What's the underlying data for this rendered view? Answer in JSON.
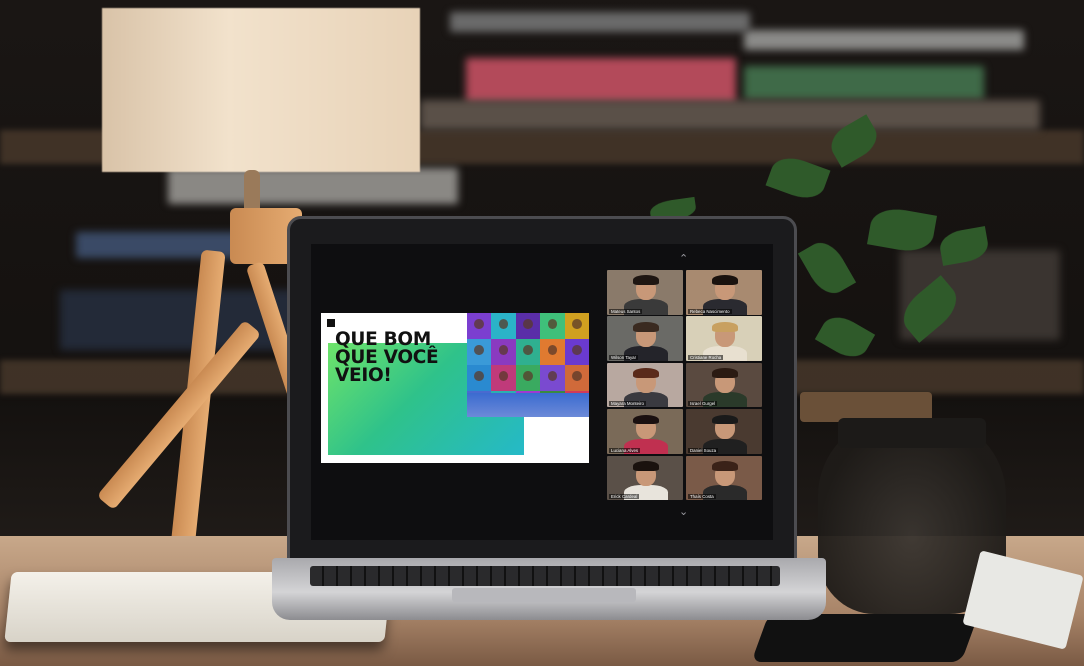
{
  "slide": {
    "title_lines": [
      "QUE BOM",
      "QUE VOCÊ",
      "VEIO!"
    ],
    "gradient_start": "#6ee36a",
    "gradient_end": "#25b9c8"
  },
  "panel": {
    "scroll_up_icon": "chevron-up-icon",
    "scroll_down_icon": "chevron-down-icon",
    "participants": [
      {
        "name": "Mateus Santos",
        "bg": "#8a7a6a",
        "shirt": "#3a3a3a",
        "hair": "#1e1612"
      },
      {
        "name": "Rebeca Nascimento",
        "bg": "#a88a70",
        "shirt": "#2a2a30",
        "hair": "#1a120e"
      },
      {
        "name": "Wilson Tayar",
        "bg": "#6a6a66",
        "shirt": "#24242a",
        "hair": "#3a2a20"
      },
      {
        "name": "Cristiane Rocha",
        "bg": "#d8d0b8",
        "shirt": "#e8e0d0",
        "hair": "#c8a060"
      },
      {
        "name": "Mayara Monteiro",
        "bg": "#b8a8a0",
        "shirt": "#3a3a40",
        "hair": "#5a2a1a"
      },
      {
        "name": "Israel Gurgel",
        "bg": "#5a4a40",
        "shirt": "#2a3a2a",
        "hair": "#2a1a12"
      },
      {
        "name": "Luciana Alves",
        "bg": "#7a6a58",
        "shirt": "#c03050",
        "hair": "#1a1010"
      },
      {
        "name": "Daniel Souza",
        "bg": "#4a3a30",
        "shirt": "#202020",
        "hair": "#1a1a1a"
      },
      {
        "name": "Erick Cardeal",
        "bg": "#5a5048",
        "shirt": "#e8e4dc",
        "hair": "#1a120e"
      },
      {
        "name": "Thaís Costa",
        "bg": "#7a5a48",
        "shirt": "#2a2a2a",
        "hair": "#3a2218"
      }
    ]
  }
}
